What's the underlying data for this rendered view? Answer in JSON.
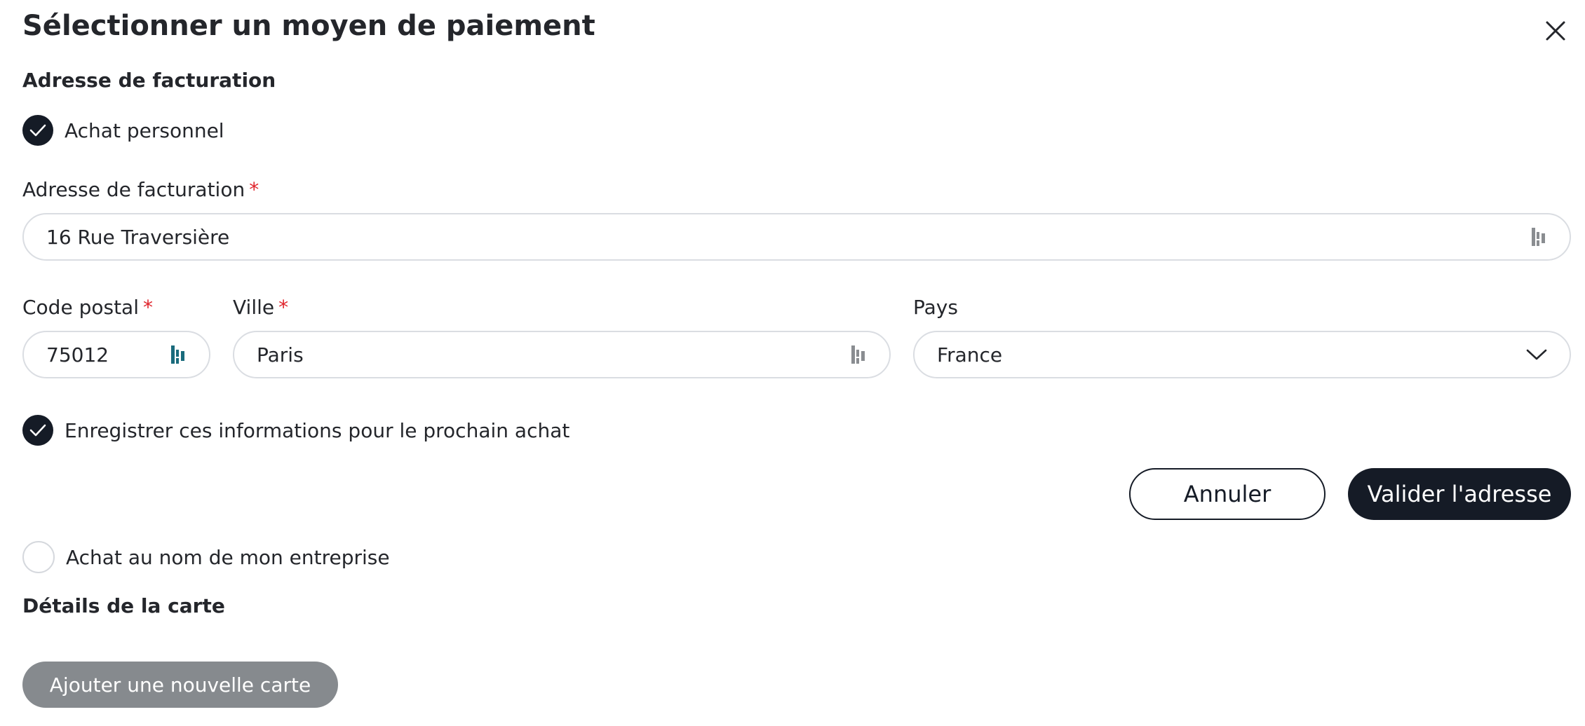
{
  "dialog": {
    "title": "Sélectionner un moyen de paiement",
    "close_icon": "close-icon"
  },
  "billing": {
    "section_title": "Adresse de facturation",
    "personal_option": {
      "label": "Achat personnel",
      "checked": true
    },
    "address_label": "Adresse de facturation",
    "address_value": "16 Rue Traversière",
    "postal_label": "Code postal",
    "postal_value": "75012",
    "city_label": "Ville",
    "city_value": "Paris",
    "country_label": "Pays",
    "country_value": "France",
    "required_mark": "*",
    "save_option": {
      "label": "Enregistrer ces informations pour le prochain achat",
      "checked": true
    },
    "cancel_label": "Annuler",
    "validate_label": "Valider l'adresse",
    "company_option": {
      "label": "Achat au nom de mon entreprise",
      "checked": false
    }
  },
  "card": {
    "section_title": "Détails de la carte",
    "add_card_label": "Ajouter une nouvelle carte"
  },
  "colors": {
    "primary": "#151b26",
    "required": "#e0242c",
    "disabled_button": "#868a8e",
    "autofill_icon_active": "#1a6b7c",
    "autofill_icon_inactive": "#8a8d91"
  }
}
